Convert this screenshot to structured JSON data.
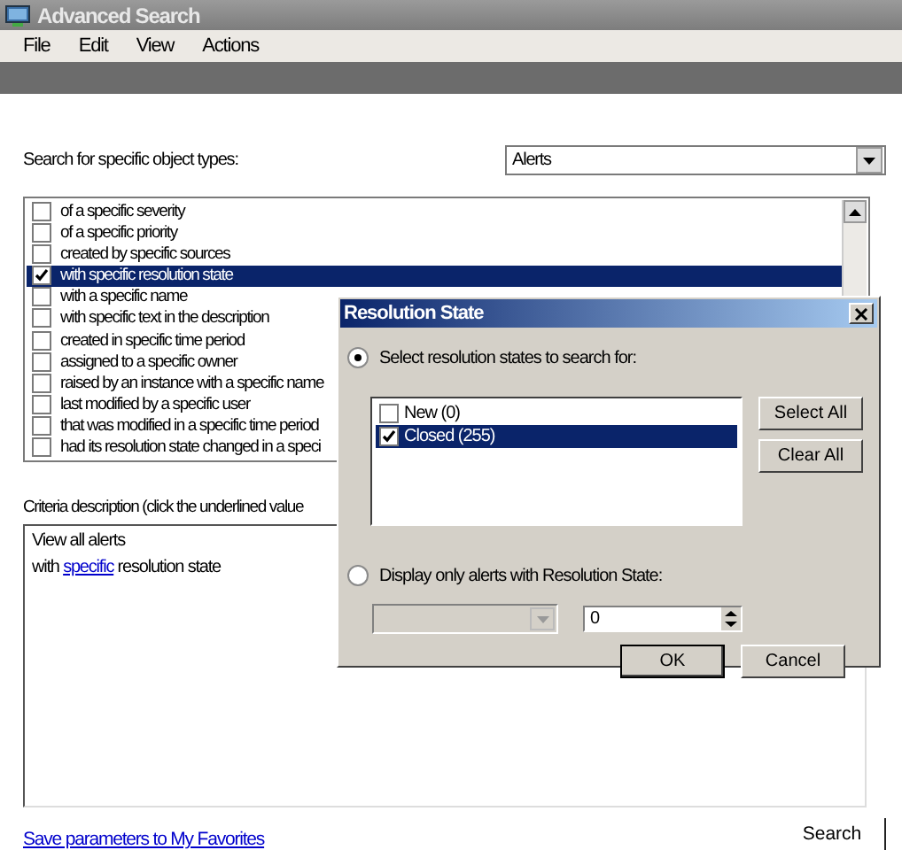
{
  "window": {
    "title": "Advanced Search"
  },
  "menu": [
    "File",
    "Edit",
    "View",
    "Actions"
  ],
  "object_type": {
    "label": "Search for specific object types:",
    "value": "Alerts"
  },
  "criteria": [
    {
      "label": "of a specific severity",
      "checked": false,
      "selected": false
    },
    {
      "label": "of a specific priority",
      "checked": false,
      "selected": false
    },
    {
      "label": "created by specific sources",
      "checked": false,
      "selected": false
    },
    {
      "label": "with specific resolution state",
      "checked": true,
      "selected": true
    },
    {
      "label": "with a specific name",
      "checked": false,
      "selected": false
    },
    {
      "label": "with specific text in the description",
      "checked": false,
      "selected": false
    },
    {
      "label": "created in specific time period",
      "checked": false,
      "selected": false
    },
    {
      "label": "assigned to a specific owner",
      "checked": false,
      "selected": false
    },
    {
      "label": "raised by an instance with a specific name",
      "checked": false,
      "selected": false
    },
    {
      "label": "last modified by a specific user",
      "checked": false,
      "selected": false
    },
    {
      "label": "that was modified in a specific time period",
      "checked": false,
      "selected": false
    },
    {
      "label": "had its resolution state changed in a speci",
      "checked": false,
      "selected": false
    }
  ],
  "criteria_description": {
    "label": "Criteria description (click the underlined value",
    "first_line": "View all alerts",
    "second_line": {
      "before": "with ",
      "link": "specific",
      "after": " resolution state"
    }
  },
  "save_link": "Save parameters to My Favorites",
  "search_button": "Search",
  "dialog": {
    "title": "Resolution State",
    "options": [
      {
        "label": "Select resolution states to search for:",
        "selected": true
      },
      {
        "label": "Display only alerts with Resolution State:",
        "selected": false
      }
    ],
    "states": [
      {
        "label": "New (0)",
        "checked": false,
        "selected": false
      },
      {
        "label": "Closed (255)",
        "checked": true,
        "selected": true
      }
    ],
    "list_buttons": [
      "Select All",
      "Clear All"
    ],
    "state_combo": {
      "disabled": true
    },
    "number_field": {
      "value": "0"
    },
    "ok_button": "OK",
    "cancel_button": "Cancel"
  }
}
